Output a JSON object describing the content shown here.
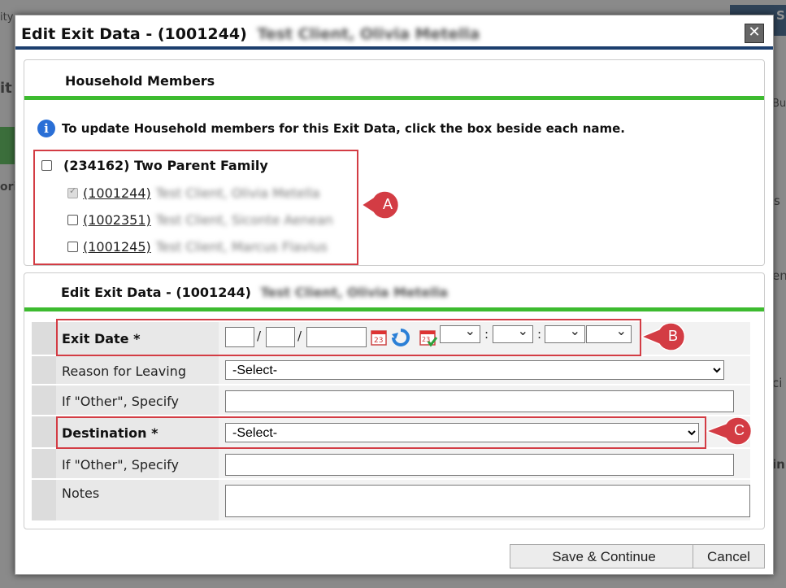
{
  "dialog": {
    "title": "Edit Exit Data - (1001244)",
    "title_blurred": "Test Client, Olivia Metella",
    "close_glyph": "✕"
  },
  "household": {
    "section_title": "Household Members",
    "info_text": "To update Household members for this Exit Data, click the box beside each name.",
    "family": {
      "label": "(234162) Two Parent Family",
      "checked": false
    },
    "members": [
      {
        "id": "(1001244)",
        "name": "Test Client, Olivia Metella",
        "checked": true,
        "disabled": true
      },
      {
        "id": "(1002351)",
        "name": "Test Client, Siconte Aenean",
        "checked": false,
        "disabled": false
      },
      {
        "id": "(1001245)",
        "name": "Test Client, Marcus Flavius",
        "checked": false,
        "disabled": false
      }
    ]
  },
  "edit": {
    "section_title": "Edit Exit Data - (1001244)",
    "section_title_blurred": "Test Client, Olivia Metella",
    "fields": {
      "exit_date": "Exit Date",
      "reason": "Reason for Leaving",
      "other1": "If \"Other\", Specify",
      "destination": "Destination",
      "other2": "If \"Other\", Specify",
      "notes": "Notes"
    },
    "required_mark": "*",
    "date_sep": "/",
    "time_sep": ":",
    "reason_value": "-Select-",
    "destination_value": "-Select-"
  },
  "callouts": {
    "a": "A",
    "b": "B",
    "c": "C"
  },
  "buttons": {
    "save": "Save & Continue",
    "cancel": "Cancel"
  },
  "background": {
    "frag_ity": "ity",
    "frag_it": "it",
    "frag_s": "S",
    "frag_ori": "ori",
    "frag_bu": "Bu",
    "frag_s2": "s",
    "frag_en": "en",
    "frag_ci": "ci",
    "frag_in": "in"
  },
  "colors": {
    "accent_green": "#3dbb2f",
    "header_blue": "#1c3f6e",
    "callout_red": "#d33c44"
  }
}
